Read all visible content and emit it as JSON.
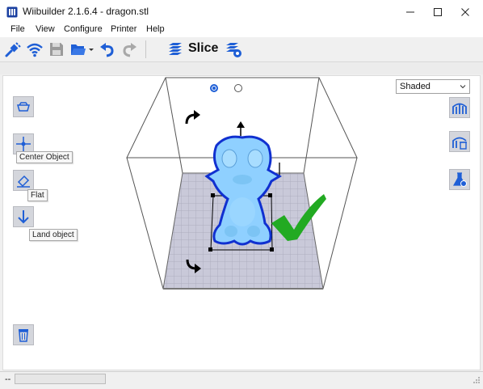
{
  "window": {
    "title": "Wiibuilder 2.1.6.4 - dragon.stl"
  },
  "menu": {
    "items": [
      "File",
      "View",
      "Configure",
      "Printer",
      "Help"
    ]
  },
  "toolbar": {
    "slice_label": "Slice"
  },
  "view": {
    "mode_select": {
      "selected": "Shaded"
    },
    "tooltips": {
      "center": "Center Object",
      "flat": "Flat",
      "land": "Land object"
    },
    "radio_selected": 0
  },
  "status": {
    "text": "--",
    "progress": 0
  },
  "colors": {
    "accent": "#1f5fd6",
    "model": "#8fd0ff",
    "model_outline": "#1030d0",
    "checkmark": "#22aa22",
    "bed": "#c8c8d8",
    "button_bg": "#d4d6dc"
  }
}
